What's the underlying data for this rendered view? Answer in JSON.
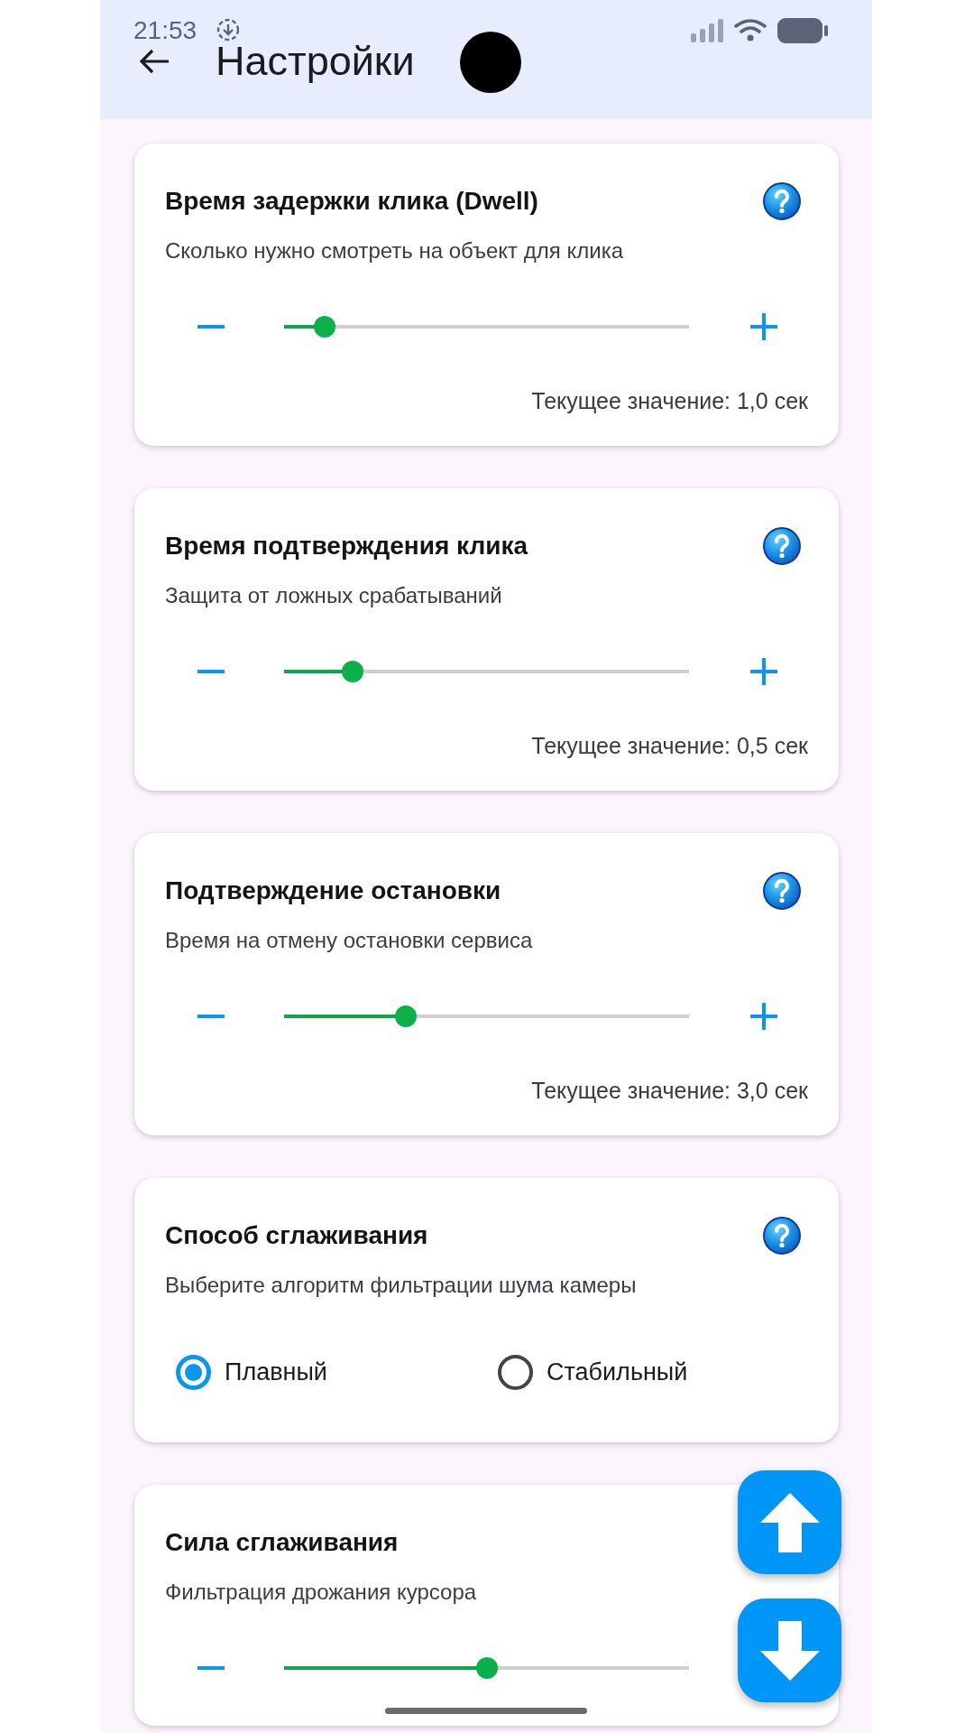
{
  "status_bar": {
    "time": "21:53"
  },
  "app_bar": {
    "title": "Настройки"
  },
  "cards": [
    {
      "kind": "slider",
      "title": "Время задержки клика (Dwell)",
      "help_button": true,
      "subtitle": "Сколько нужно смотреть на объект для клика",
      "steppers": [
        {
          "kind": "minus"
        },
        {
          "kind": "plus"
        }
      ],
      "level": 0.1,
      "value_text": "Текущее значение: 1,0 сек"
    },
    {
      "kind": "slider",
      "title": "Время подтверждения клика",
      "help_button": true,
      "subtitle": "Защита от ложных срабатываний",
      "steppers": [
        {
          "kind": "minus"
        },
        {
          "kind": "plus"
        }
      ],
      "level": 0.17,
      "value_text": "Текущее значение: 0,5 сек"
    },
    {
      "kind": "slider",
      "title": "Подтверждение остановки",
      "help_button": true,
      "subtitle": "Время на отмену остановки сервиса",
      "steppers": [
        {
          "kind": "minus"
        },
        {
          "kind": "plus"
        }
      ],
      "level": 0.3,
      "value_text": "Текущее значение: 3,0 сек"
    },
    {
      "kind": "radio",
      "title": "Способ сглаживания",
      "help_button": true,
      "subtitle": "Выберите алгоритм фильтрации шума камеры",
      "options": [
        {
          "label": "Плавный",
          "selected": true
        },
        {
          "label": "Стабильный",
          "selected": false
        }
      ]
    },
    {
      "kind": "slider",
      "title": "Сила сглаживания",
      "help_button": false,
      "subtitle": "Фильтрация дрожания курсора",
      "steppers": [
        {
          "kind": "minus"
        }
      ],
      "level": 0.5
    }
  ]
}
